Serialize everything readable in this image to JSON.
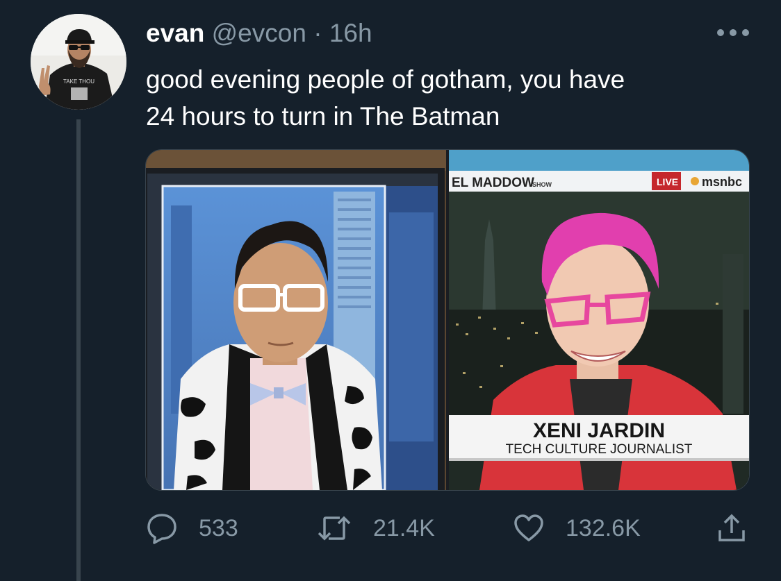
{
  "author": {
    "display_name": "evan",
    "handle": "@evcon",
    "separator": "·",
    "timestamp": "16h",
    "avatar_shirt_text": "TAKE THOU"
  },
  "tweet": {
    "text": "good evening people of gotham, you have\n24 hours to turn in The Batman"
  },
  "media": {
    "right_panel": {
      "show_banner": "EL MADDOW",
      "show_banner_suffix": "SHOW",
      "live_label": "LIVE",
      "network_label": "msnbc",
      "lower_third_name": "XENI JARDIN",
      "lower_third_title": "TECH CULTURE JOURNALIST"
    }
  },
  "actions": {
    "reply_count": "533",
    "retweet_count": "21.4K",
    "like_count": "132.6K"
  },
  "colors": {
    "background": "#15202b",
    "secondary_text": "#8899a6",
    "divider": "#38444d"
  },
  "icons": [
    "more-icon",
    "reply-icon",
    "retweet-icon",
    "like-icon",
    "share-icon"
  ]
}
